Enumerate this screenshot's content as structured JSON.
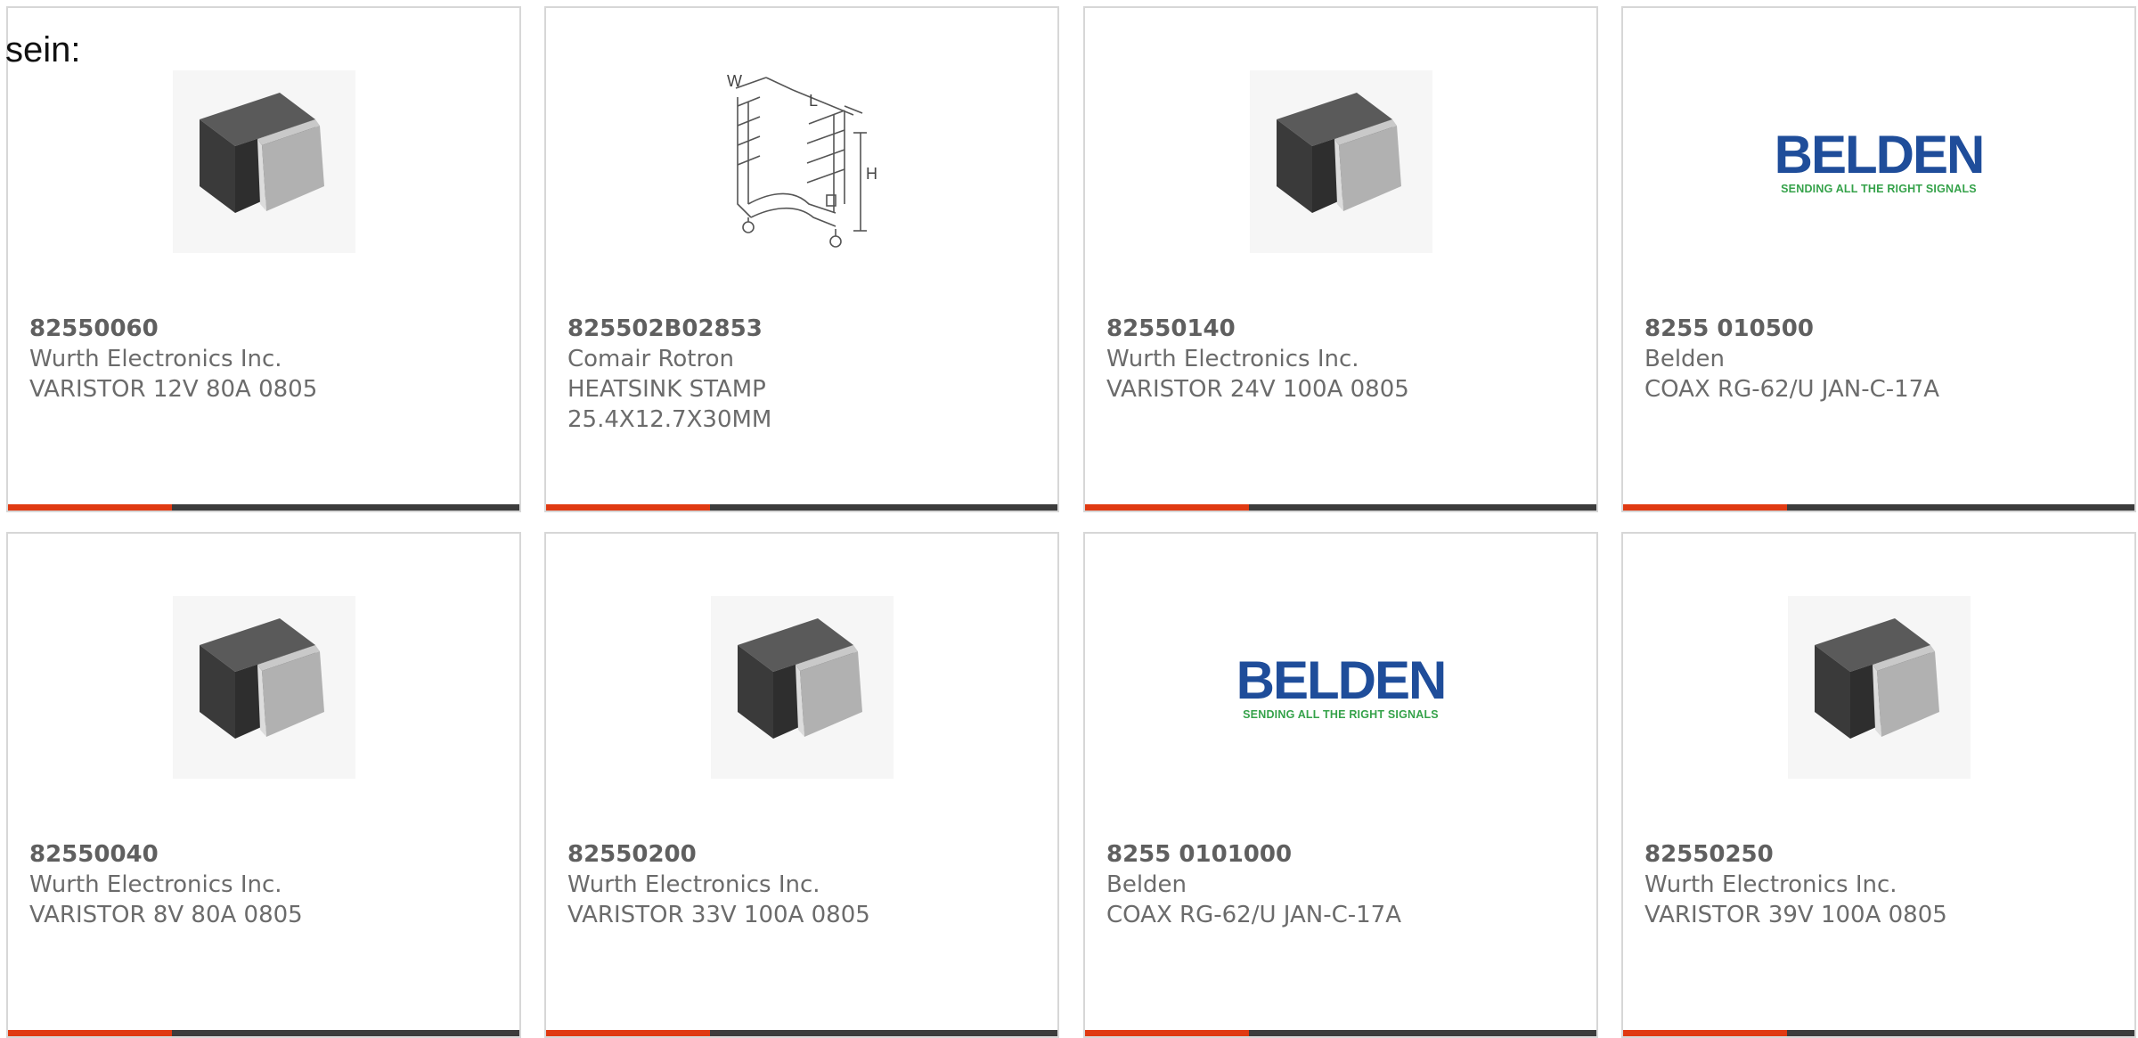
{
  "intro": "sein:",
  "colors": {
    "progress_fill": "#e03a12",
    "progress_track": "#3c3c3c",
    "belden_blue": "#1f4d9a",
    "belden_green": "#35a24a",
    "text_gray": "#6b6b6b"
  },
  "products": [
    {
      "part_number": "82550060",
      "manufacturer": "Wurth Electronics Inc.",
      "description": [
        "VARISTOR 12V 80A 0805"
      ],
      "image": "smd-chip-icon",
      "progress": 0.32
    },
    {
      "part_number": "825502B02853",
      "manufacturer": "Comair Rotron",
      "description": [
        "HEATSINK STAMP",
        "25.4X12.7X30MM"
      ],
      "image": "heatsink-drawing-icon",
      "progress": 0.32
    },
    {
      "part_number": "82550140",
      "manufacturer": "Wurth Electronics Inc.",
      "description": [
        "VARISTOR 24V 100A 0805"
      ],
      "image": "smd-chip-icon",
      "progress": 0.32
    },
    {
      "part_number": "8255 010500",
      "manufacturer": "Belden",
      "description": [
        "COAX RG-62/U JAN-C-17A"
      ],
      "image": "belden-logo",
      "progress": 0.32
    },
    {
      "part_number": "82550040",
      "manufacturer": "Wurth Electronics Inc.",
      "description": [
        "VARISTOR 8V 80A 0805"
      ],
      "image": "smd-chip-icon",
      "progress": 0.32
    },
    {
      "part_number": "82550200",
      "manufacturer": "Wurth Electronics Inc.",
      "description": [
        "VARISTOR 33V 100A 0805"
      ],
      "image": "smd-chip-icon",
      "progress": 0.32
    },
    {
      "part_number": "8255 0101000",
      "manufacturer": "Belden",
      "description": [
        "COAX RG-62/U JAN-C-17A"
      ],
      "image": "belden-logo",
      "progress": 0.32
    },
    {
      "part_number": "82550250",
      "manufacturer": "Wurth Electronics Inc.",
      "description": [
        "VARISTOR 39V 100A 0805"
      ],
      "image": "smd-chip-icon",
      "progress": 0.32
    }
  ],
  "belden": {
    "word": "BELDEN",
    "tagline": "SENDING ALL THE RIGHT SIGNALS"
  },
  "heatsink_labels": {
    "w": "W",
    "l": "L",
    "h": "H"
  }
}
